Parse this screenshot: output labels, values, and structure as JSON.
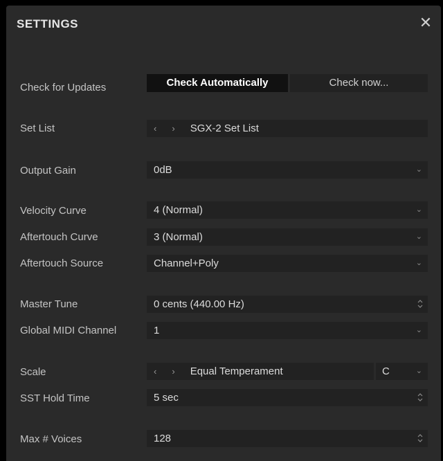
{
  "dialog": {
    "title": "SETTINGS",
    "close_glyph": "✕"
  },
  "updates": {
    "label": "Check for Updates",
    "auto_button": "Check Automatically",
    "now_button": "Check now..."
  },
  "set_list": {
    "label": "Set List",
    "prev": "‹",
    "next": "›",
    "value": "SGX-2 Set List"
  },
  "output_gain": {
    "label": "Output Gain",
    "value": "0dB"
  },
  "velocity_curve": {
    "label": "Velocity Curve",
    "value": "4 (Normal)"
  },
  "aftertouch_curve": {
    "label": "Aftertouch Curve",
    "value": "3 (Normal)"
  },
  "aftertouch_source": {
    "label": "Aftertouch Source",
    "value": "Channel+Poly"
  },
  "master_tune": {
    "label": "Master Tune",
    "value": "0 cents (440.00 Hz)"
  },
  "midi_channel": {
    "label": "Global MIDI Channel",
    "value": "1"
  },
  "scale": {
    "label": "Scale",
    "prev": "‹",
    "next": "›",
    "value": "Equal Temperament",
    "key": "C"
  },
  "sst_hold": {
    "label": "SST Hold Time",
    "value": "5 sec"
  },
  "max_voices": {
    "label": "Max # Voices",
    "value": "128"
  },
  "icons": {
    "dropdown": "chevron-down-icon",
    "stepper": "up-down-stepper-icon",
    "close": "close-icon"
  }
}
